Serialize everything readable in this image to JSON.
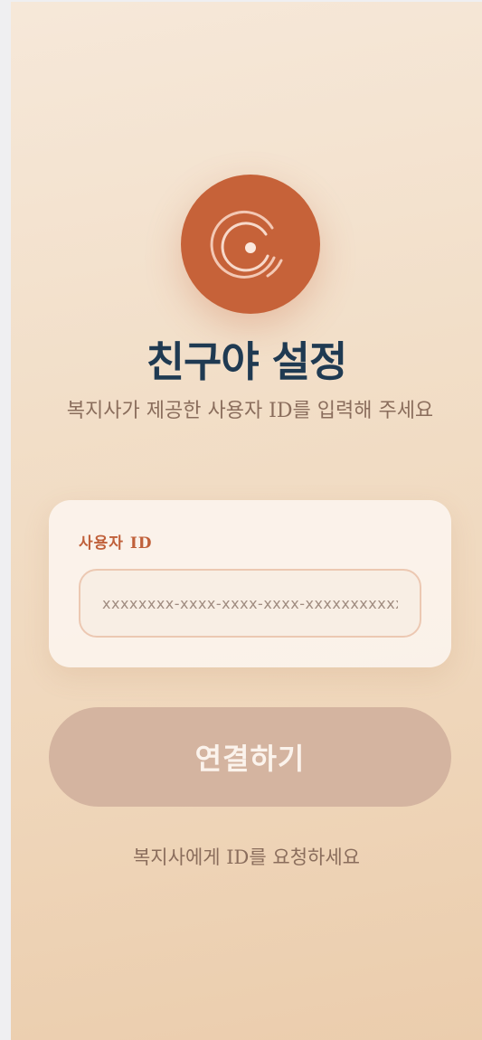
{
  "brand": {
    "logo_icon": "vinyl-record-icon",
    "accent_color": "#c66239"
  },
  "header": {
    "title": "친구야 설정",
    "subtitle": "복지사가 제공한 사용자 ID를 입력해 주세요"
  },
  "form": {
    "user_id_label": "사용자 ID",
    "user_id_placeholder": "xxxxxxxx-xxxx-xxxx-xxxx-xxxxxxxxxxxx",
    "user_id_value": ""
  },
  "actions": {
    "connect_label": "연결하기"
  },
  "footer": {
    "hint": "복지사에게 ID를 요청하세요"
  }
}
